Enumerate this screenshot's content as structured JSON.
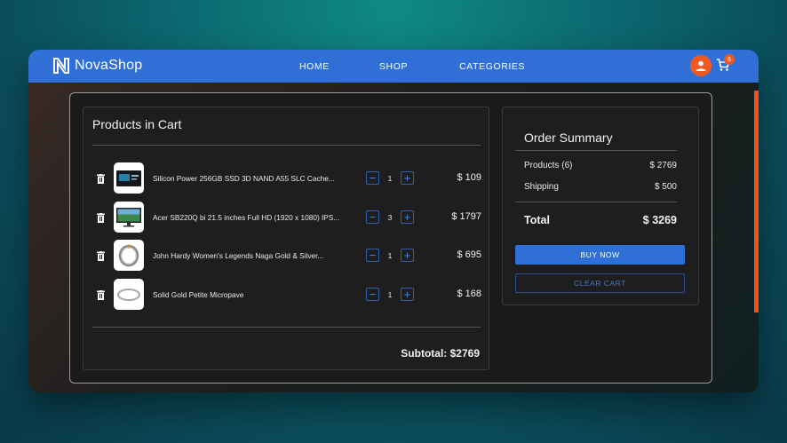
{
  "nav": {
    "brand": "NovaShop",
    "links": [
      "HOME",
      "SHOP",
      "CATEGORIES"
    ],
    "cart_count": "6"
  },
  "cart": {
    "title": "Products in Cart",
    "items": [
      {
        "name": "Silicon Power 256GB SSD 3D NAND A55 SLC Cache...",
        "qty": "1",
        "price": "$ 109",
        "thumb": "ssd"
      },
      {
        "name": "Acer SB220Q bi 21.5 inches Full HD (1920 x 1080) IPS...",
        "qty": "3",
        "price": "$ 1797",
        "thumb": "monitor"
      },
      {
        "name": "John Hardy Women's Legends Naga Gold & Silver...",
        "qty": "1",
        "price": "$ 695",
        "thumb": "bracelet"
      },
      {
        "name": "Solid Gold Petite Micropave",
        "qty": "1",
        "price": "$ 168",
        "thumb": "ring"
      }
    ],
    "subtotal": "Subtotal: $2769"
  },
  "summary": {
    "title": "Order Summary",
    "products_label": "Products (6)",
    "products_value": "$ 2769",
    "shipping_label": "Shipping",
    "shipping_value": "$ 500",
    "total_label": "Total",
    "total_value": "$ 3269",
    "buy_label": "BUY NOW",
    "clear_label": "CLEAR CART"
  },
  "colors": {
    "navbar": "#2f6fd6",
    "accent": "#f05a22",
    "panel": "#1e1e1e"
  }
}
